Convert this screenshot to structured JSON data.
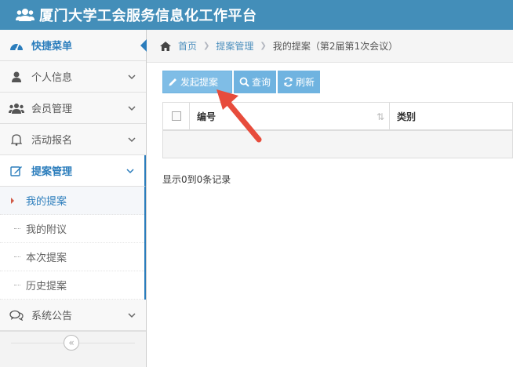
{
  "app": {
    "title": "厦门大学工会服务信息化工作平台"
  },
  "sidebar": {
    "items": [
      {
        "label": "快捷菜单",
        "icon": "dashboard-icon"
      },
      {
        "label": "个人信息",
        "icon": "user-icon"
      },
      {
        "label": "会员管理",
        "icon": "users-icon"
      },
      {
        "label": "活动报名",
        "icon": "bell-icon"
      },
      {
        "label": "提案管理",
        "icon": "edit-icon"
      }
    ],
    "submenu": [
      {
        "label": "我的提案"
      },
      {
        "label": "我的附议"
      },
      {
        "label": "本次提案"
      },
      {
        "label": "历史提案"
      }
    ],
    "last": {
      "label": "系统公告",
      "icon": "comments-icon"
    },
    "collapse": "«"
  },
  "breadcrumb": {
    "home": "首页",
    "section": "提案管理",
    "current": "我的提案（第2届第1次会议）"
  },
  "toolbar": {
    "create_label": "发起提案",
    "query_label": "查询",
    "refresh_label": "刷新"
  },
  "table": {
    "col_no": "编号",
    "col_type": "类别",
    "sort_glyph": "⇅"
  },
  "status": {
    "records": "显示0到0条记录"
  },
  "colors": {
    "header": "#438eb9",
    "accent": "#2b7dbc",
    "button": "#6fb3e0",
    "annotation": "#e74c3c"
  }
}
